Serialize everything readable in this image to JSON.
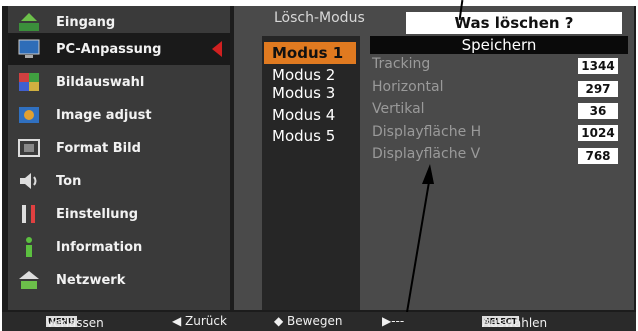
{
  "sidebar": {
    "items": [
      {
        "label": "Eingang",
        "icon": "input-icon"
      },
      {
        "label": "PC-Anpassung",
        "icon": "monitor-icon"
      },
      {
        "label": "Bildauswahl",
        "icon": "image-select-icon"
      },
      {
        "label": "Image adjust",
        "icon": "image-adjust-icon"
      },
      {
        "label": "Format Bild",
        "icon": "screen-format-icon"
      },
      {
        "label": "Ton",
        "icon": "speaker-icon"
      },
      {
        "label": "Einstellung",
        "icon": "tools-icon"
      },
      {
        "label": "Information",
        "icon": "info-icon"
      },
      {
        "label": "Netzwerk",
        "icon": "network-icon"
      }
    ]
  },
  "main": {
    "header_label": "Lösch-Modus",
    "header_box": "Was löschen ?",
    "modes": [
      "Modus 1",
      "Modus 2",
      "Modus 3",
      "Modus 4",
      "Modus 5"
    ],
    "store_label": "Speichern",
    "params": [
      {
        "label": "Tracking",
        "value": "1344"
      },
      {
        "label": "Horizontal",
        "value": "297"
      },
      {
        "label": "Vertikal",
        "value": "36"
      },
      {
        "label": "Displayfläche H",
        "value": "1024"
      },
      {
        "label": "Displayfläche V",
        "value": "768"
      }
    ]
  },
  "help_bar": {
    "menu_key": "MENU",
    "exit_label": "Verlassen",
    "back_label": "◀ Zurück",
    "move_label": "◆ Bewegen",
    "next_label": "▶---",
    "select_key": "SELECT",
    "select_label": "Auswählen"
  },
  "colors": {
    "accent": "#e07a20",
    "pointer": "#d02020",
    "panel": "#4a4a4a",
    "sidebar": "#3a3a3a"
  }
}
